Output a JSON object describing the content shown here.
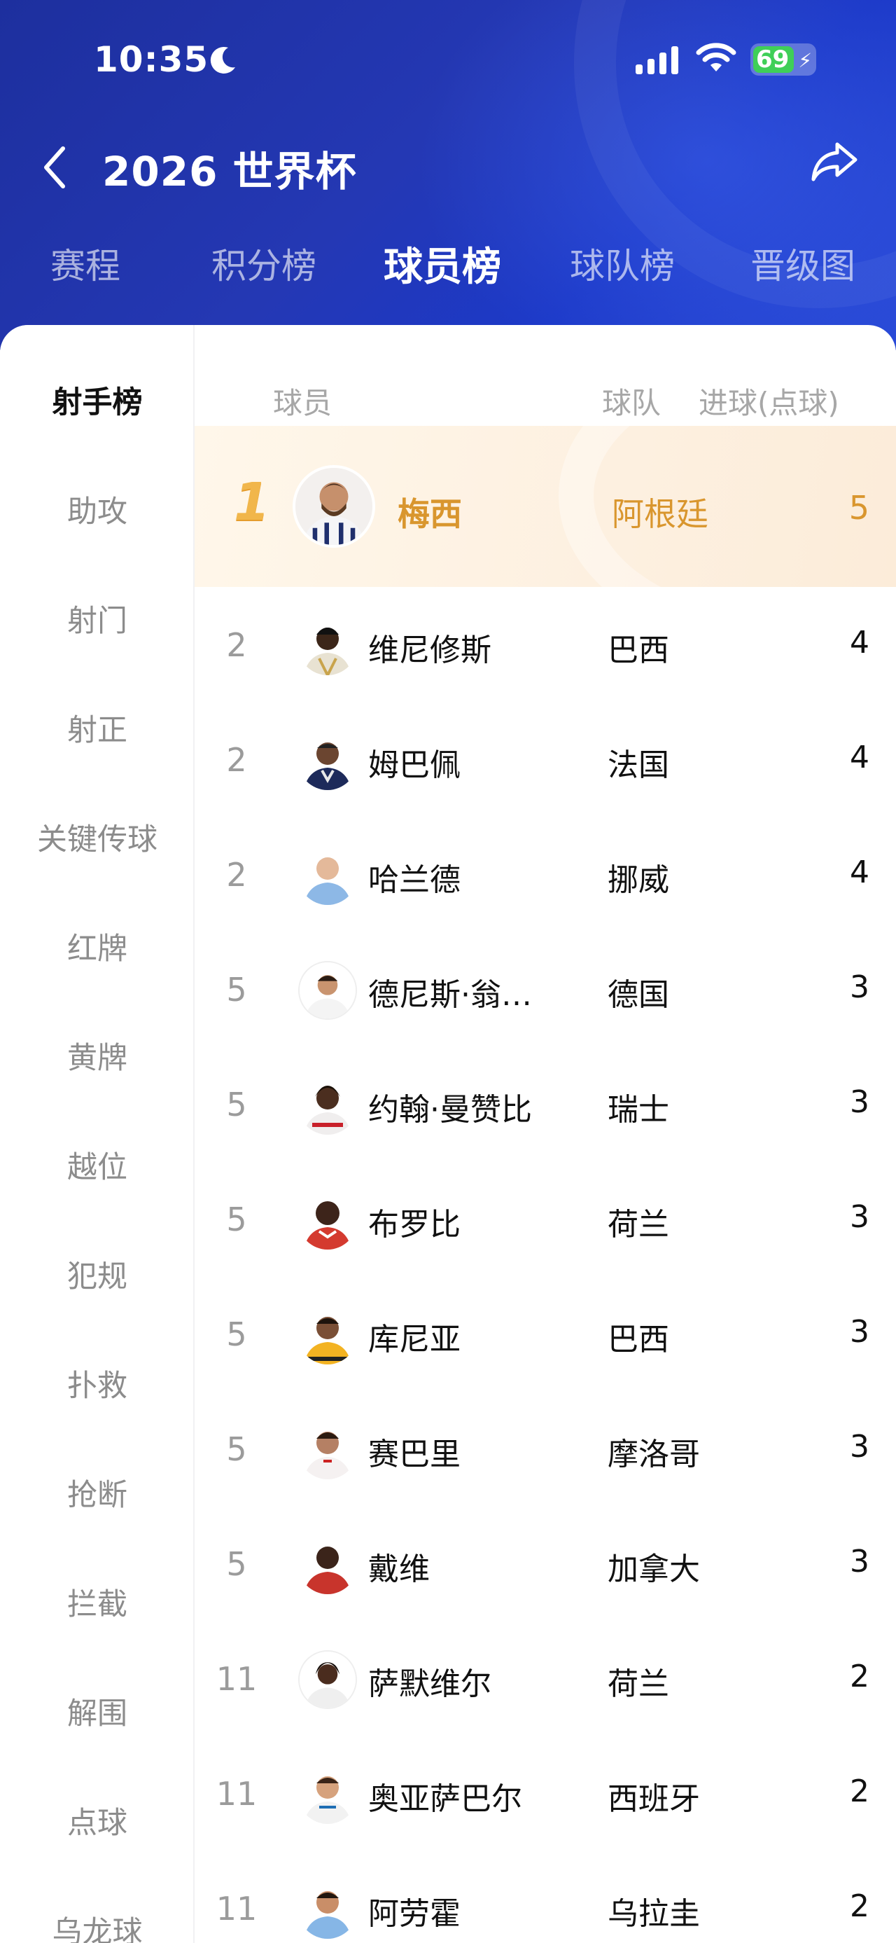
{
  "status_bar": {
    "time": "10:35",
    "battery": "69"
  },
  "nav": {
    "title": "2026 世界杯"
  },
  "tabs": [
    {
      "label": "赛程"
    },
    {
      "label": "积分榜"
    },
    {
      "label": "球员榜"
    },
    {
      "label": "球队榜"
    },
    {
      "label": "晋级图"
    }
  ],
  "active_tab": "球员榜",
  "sidebar": {
    "items": [
      {
        "label": "射手榜"
      },
      {
        "label": "助攻"
      },
      {
        "label": "射门"
      },
      {
        "label": "射正"
      },
      {
        "label": "关键传球"
      },
      {
        "label": "红牌"
      },
      {
        "label": "黄牌"
      },
      {
        "label": "越位"
      },
      {
        "label": "犯规"
      },
      {
        "label": "扑救"
      },
      {
        "label": "抢断"
      },
      {
        "label": "拦截"
      },
      {
        "label": "解围"
      },
      {
        "label": "点球"
      },
      {
        "label": "乌龙球"
      }
    ]
  },
  "table": {
    "headers": {
      "player": "球员",
      "team": "球队",
      "goals": "进球(点球)"
    },
    "rows": [
      {
        "rank": "1",
        "name": "梅西",
        "team": "阿根廷",
        "goals": "5"
      },
      {
        "rank": "2",
        "name": "维尼修斯",
        "team": "巴西",
        "goals": "4"
      },
      {
        "rank": "2",
        "name": "姆巴佩",
        "team": "法国",
        "goals": "4"
      },
      {
        "rank": "2",
        "name": "哈兰德",
        "team": "挪威",
        "goals": "4"
      },
      {
        "rank": "5",
        "name": "德尼斯·翁…",
        "team": "德国",
        "goals": "3"
      },
      {
        "rank": "5",
        "name": "约翰·曼赞比",
        "team": "瑞士",
        "goals": "3"
      },
      {
        "rank": "5",
        "name": "布罗比",
        "team": "荷兰",
        "goals": "3"
      },
      {
        "rank": "5",
        "name": "库尼亚",
        "team": "巴西",
        "goals": "3"
      },
      {
        "rank": "5",
        "name": "赛巴里",
        "team": "摩洛哥",
        "goals": "3"
      },
      {
        "rank": "5",
        "name": "戴维",
        "team": "加拿大",
        "goals": "3"
      },
      {
        "rank": "11",
        "name": "萨默维尔",
        "team": "荷兰",
        "goals": "2"
      },
      {
        "rank": "11",
        "name": "奥亚萨巴尔",
        "team": "西班牙",
        "goals": "2"
      },
      {
        "rank": "11",
        "name": "阿劳霍",
        "team": "乌拉圭",
        "goals": "2"
      }
    ]
  },
  "colors": {
    "header_blue": "#1f34ae",
    "highlight_gold": "#d9962e",
    "active_text": "#111111",
    "inactive_text": "#8c8c8c"
  }
}
